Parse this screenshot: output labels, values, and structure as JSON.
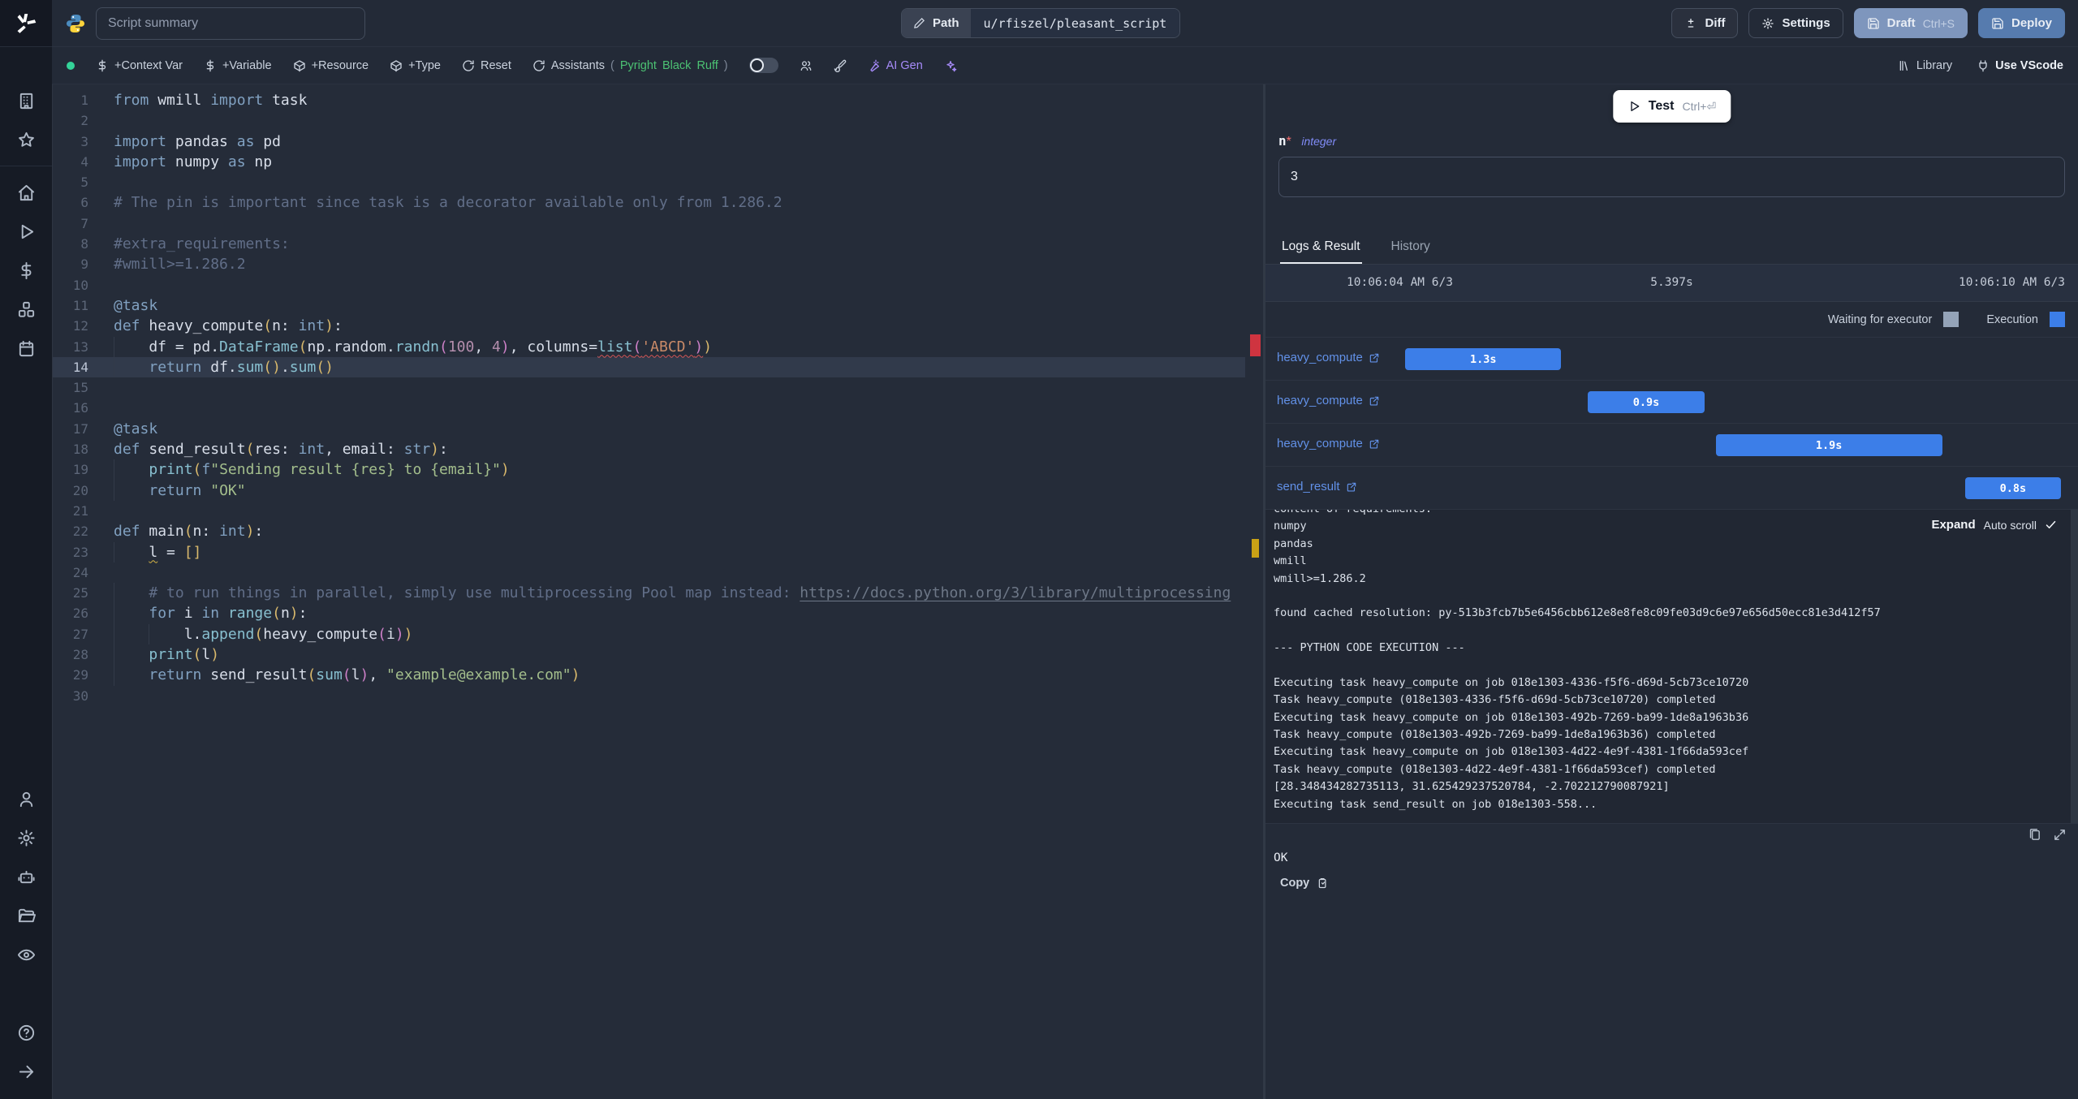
{
  "topbar": {
    "summary_placeholder": "Script summary",
    "path_label": "Path",
    "path_value": "u/rfiszel/pleasant_script",
    "diff_label": "Diff",
    "settings_label": "Settings",
    "draft_label": "Draft",
    "draft_shortcut": "Ctrl+S",
    "deploy_label": "Deploy"
  },
  "toolbar": {
    "add_context_var": "+Context Var",
    "add_variable": "+Variable",
    "add_resource": "+Resource",
    "add_type": "+Type",
    "reset": "Reset",
    "assistants": "Assistants",
    "paren_open": "(",
    "lint_pyright": "Pyright",
    "lint_black": "Black",
    "lint_ruff": "Ruff",
    "paren_close": ")",
    "ai_gen": "AI Gen",
    "library": "Library",
    "use_vscode": "Use VScode",
    "status_color": "#34d399"
  },
  "sidebar_icon_names": [
    "windmill-logo",
    "building-icon",
    "star-icon",
    "home-icon",
    "play-icon",
    "dollar-icon",
    "resources-icon",
    "calendar-icon",
    "user-icon",
    "gear-icon",
    "robot-icon",
    "folder-icon",
    "eye-icon",
    "help-icon",
    "arrow-right-icon"
  ],
  "editor": {
    "active_line": 14,
    "lines": [
      {
        "n": 1,
        "s": [
          [
            "kw",
            "from"
          ],
          [
            "tx",
            " wmill "
          ],
          [
            "kw",
            "import"
          ],
          [
            "tx",
            " task"
          ]
        ]
      },
      {
        "n": 2,
        "s": []
      },
      {
        "n": 3,
        "s": [
          [
            "kw",
            "import"
          ],
          [
            "tx",
            " pandas "
          ],
          [
            "kw",
            "as"
          ],
          [
            "tx",
            " pd"
          ]
        ]
      },
      {
        "n": 4,
        "s": [
          [
            "kw",
            "import"
          ],
          [
            "tx",
            " numpy "
          ],
          [
            "kw",
            "as"
          ],
          [
            "tx",
            " np"
          ]
        ]
      },
      {
        "n": 5,
        "s": []
      },
      {
        "n": 6,
        "s": [
          [
            "cm",
            "# The pin is important since task is a decorator available only from 1.286.2"
          ]
        ]
      },
      {
        "n": 7,
        "s": []
      },
      {
        "n": 8,
        "s": [
          [
            "cm",
            "#extra_requirements:"
          ]
        ]
      },
      {
        "n": 9,
        "s": [
          [
            "cm",
            "#wmill>=1.286.2"
          ]
        ]
      },
      {
        "n": 10,
        "s": []
      },
      {
        "n": 11,
        "s": [
          [
            "kw",
            "@task"
          ]
        ]
      },
      {
        "n": 12,
        "s": [
          [
            "kw",
            "def"
          ],
          [
            "tx",
            " heavy_compute"
          ],
          [
            "b1",
            "("
          ],
          [
            "tx",
            "n: "
          ],
          [
            "kw",
            "int"
          ],
          [
            "b1",
            ")"
          ],
          [
            "tx",
            ":"
          ]
        ]
      },
      {
        "n": 13,
        "g": 1,
        "s": [
          [
            "tx",
            "    df = pd."
          ],
          [
            "fn",
            "DataFrame"
          ],
          [
            "b1",
            "("
          ],
          [
            "tx",
            "np.random."
          ],
          [
            "fn",
            "randn"
          ],
          [
            "b2",
            "("
          ],
          [
            "num",
            "100"
          ],
          [
            "tx",
            ", "
          ],
          [
            "num",
            "4"
          ],
          [
            "b2",
            ")"
          ],
          [
            "tx",
            ", columns="
          ],
          [
            "fn sq",
            "list"
          ],
          [
            "b2 sq",
            "("
          ],
          [
            "so sq",
            "'ABCD'"
          ],
          [
            "b2 sq",
            ")"
          ],
          [
            "b1",
            ")"
          ]
        ]
      },
      {
        "n": 14,
        "g": 1,
        "s": [
          [
            "tx",
            "    "
          ],
          [
            "kw",
            "return"
          ],
          [
            "tx",
            " df."
          ],
          [
            "fn",
            "sum"
          ],
          [
            "b1",
            "()"
          ],
          [
            "tx",
            "."
          ],
          [
            "fn",
            "sum"
          ],
          [
            "b1",
            "()"
          ]
        ]
      },
      {
        "n": 15,
        "s": []
      },
      {
        "n": 16,
        "s": []
      },
      {
        "n": 17,
        "s": [
          [
            "kw",
            "@task"
          ]
        ]
      },
      {
        "n": 18,
        "s": [
          [
            "kw",
            "def"
          ],
          [
            "tx",
            " send_result"
          ],
          [
            "b1",
            "("
          ],
          [
            "tx",
            "res: "
          ],
          [
            "kw",
            "int"
          ],
          [
            "tx",
            ", email: "
          ],
          [
            "kw",
            "str"
          ],
          [
            "b1",
            ")"
          ],
          [
            "tx",
            ":"
          ]
        ]
      },
      {
        "n": 19,
        "g": 1,
        "s": [
          [
            "tx",
            "    "
          ],
          [
            "fn",
            "print"
          ],
          [
            "b1",
            "("
          ],
          [
            "kw",
            "f"
          ],
          [
            "st",
            "\"Sending result {res} to {email}\""
          ],
          [
            "b1",
            ")"
          ]
        ]
      },
      {
        "n": 20,
        "g": 1,
        "s": [
          [
            "tx",
            "    "
          ],
          [
            "kw",
            "return"
          ],
          [
            "tx",
            " "
          ],
          [
            "st",
            "\"OK\""
          ]
        ]
      },
      {
        "n": 21,
        "s": []
      },
      {
        "n": 22,
        "s": [
          [
            "kw",
            "def"
          ],
          [
            "tx",
            " main"
          ],
          [
            "b1",
            "("
          ],
          [
            "tx",
            "n: "
          ],
          [
            "kw",
            "int"
          ],
          [
            "b1",
            ")"
          ],
          [
            "tx",
            ":"
          ]
        ]
      },
      {
        "n": 23,
        "g": 1,
        "s": [
          [
            "tx",
            "    "
          ],
          [
            "wv",
            "l"
          ],
          [
            "tx",
            " = "
          ],
          [
            "b1",
            "[]"
          ]
        ]
      },
      {
        "n": 24,
        "s": []
      },
      {
        "n": 25,
        "g": 1,
        "s": [
          [
            "cm",
            "    # to run things in parallel, simply use multiprocessing Pool map instead: "
          ],
          [
            "lk",
            "https://docs.python.org/3/library/multiprocessing"
          ]
        ]
      },
      {
        "n": 26,
        "g": 1,
        "s": [
          [
            "tx",
            "    "
          ],
          [
            "kw",
            "for"
          ],
          [
            "tx",
            " i "
          ],
          [
            "kw",
            "in"
          ],
          [
            "tx",
            " "
          ],
          [
            "fn",
            "range"
          ],
          [
            "b1",
            "("
          ],
          [
            "tx",
            "n"
          ],
          [
            "b1",
            ")"
          ],
          [
            "tx",
            ":"
          ]
        ]
      },
      {
        "n": 27,
        "g": 2,
        "s": [
          [
            "tx",
            "        l."
          ],
          [
            "fn",
            "append"
          ],
          [
            "b1",
            "("
          ],
          [
            "tx",
            "heavy_compute"
          ],
          [
            "b2",
            "("
          ],
          [
            "tx",
            "i"
          ],
          [
            "b2",
            ")"
          ],
          [
            "b1",
            ")"
          ]
        ]
      },
      {
        "n": 28,
        "g": 1,
        "s": [
          [
            "tx",
            "    "
          ],
          [
            "fn",
            "print"
          ],
          [
            "b1",
            "("
          ],
          [
            "tx",
            "l"
          ],
          [
            "b1",
            ")"
          ]
        ]
      },
      {
        "n": 29,
        "g": 1,
        "s": [
          [
            "tx",
            "    "
          ],
          [
            "kw",
            "return"
          ],
          [
            "tx",
            " send_result"
          ],
          [
            "b1",
            "("
          ],
          [
            "fn",
            "sum"
          ],
          [
            "b2",
            "("
          ],
          [
            "tx",
            "l"
          ],
          [
            "b2",
            ")"
          ],
          [
            "tx",
            ", "
          ],
          [
            "st",
            "\"example@example.com\""
          ],
          [
            "b1",
            ")"
          ]
        ]
      },
      {
        "n": 30,
        "s": []
      }
    ]
  },
  "panel": {
    "test_label": "Test",
    "test_shortcut": "Ctrl+⏎",
    "arg": {
      "name": "n",
      "required": "*",
      "type": "integer",
      "value": "3"
    },
    "tabs": {
      "logs": "Logs & Result",
      "history": "History"
    },
    "timeline": {
      "start": "10:06:04 AM 6/3",
      "total": "5.397s",
      "end": "10:06:10 AM 6/3",
      "legend_waiting": "Waiting for executor",
      "legend_execution": "Execution",
      "waiting_color": "#94a3b8",
      "execution_color": "#3c7ee8",
      "rows": [
        {
          "name": "heavy_compute",
          "duration": "1.3s",
          "left_pct": 17.2,
          "width_pct": 19.2
        },
        {
          "name": "heavy_compute",
          "duration": "0.9s",
          "left_pct": 39.7,
          "width_pct": 14.3
        },
        {
          "name": "heavy_compute",
          "duration": "1.9s",
          "left_pct": 55.4,
          "width_pct": 27.9
        },
        {
          "name": "send_result",
          "duration": "0.8s",
          "left_pct": 86.1,
          "width_pct": 11.8
        }
      ]
    },
    "logs": {
      "expand_label": "Expand",
      "autoscroll_label": "Auto scroll",
      "lines": [
        "content of requirements:",
        "numpy",
        "pandas",
        "wmill",
        "wmill>=1.286.2",
        "",
        "found cached resolution: py-513b3fcb7b5e6456cbb612e8e8fe8c09fe03d9c6e97e656d50ecc81e3d412f57",
        "",
        "--- PYTHON CODE EXECUTION ---",
        "",
        "Executing task heavy_compute on job 018e1303-4336-f5f6-d69d-5cb73ce10720",
        "Task heavy_compute (018e1303-4336-f5f6-d69d-5cb73ce10720) completed",
        "Executing task heavy_compute on job 018e1303-492b-7269-ba99-1de8a1963b36",
        "Task heavy_compute (018e1303-492b-7269-ba99-1de8a1963b36) completed",
        "Executing task heavy_compute on job 018e1303-4d22-4e9f-4381-1f66da593cef",
        "Task heavy_compute (018e1303-4d22-4e9f-4381-1f66da593cef) completed",
        "[28.348434282735113, 31.625429237520784, -2.702212790087921]",
        "Executing task send_result on job 018e1303-558..."
      ]
    },
    "result_value": "OK",
    "copy_label": "Copy"
  }
}
